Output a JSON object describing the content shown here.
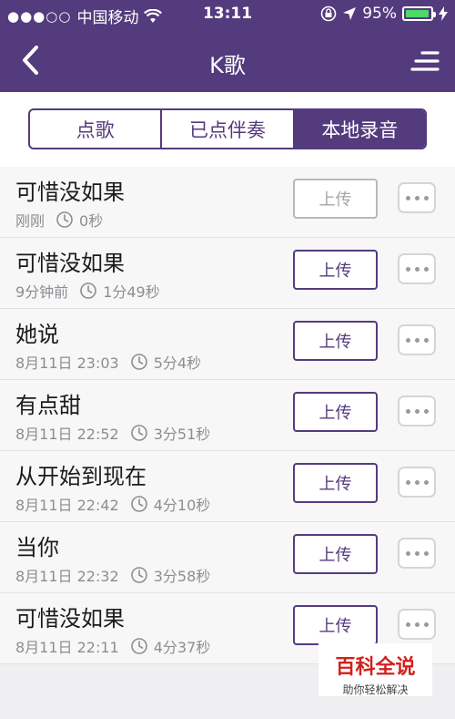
{
  "status": {
    "carrier": "中国移动",
    "time": "13:11",
    "battery_text": "95%",
    "battery_level": 0.95
  },
  "nav": {
    "title": "K歌"
  },
  "tabs": [
    {
      "label": "点歌",
      "active": false
    },
    {
      "label": "已点伴奏",
      "active": false
    },
    {
      "label": "本地录音",
      "active": true
    }
  ],
  "songs": [
    {
      "name": "可惜没如果",
      "date": "刚刚",
      "duration": "0秒",
      "upload_label": "上传",
      "upload_enabled": false
    },
    {
      "name": "可惜没如果",
      "date": "9分钟前",
      "duration": "1分49秒",
      "upload_label": "上传",
      "upload_enabled": true
    },
    {
      "name": "她说",
      "date": "8月11日 23:03",
      "duration": "5分4秒",
      "upload_label": "上传",
      "upload_enabled": true
    },
    {
      "name": "有点甜",
      "date": "8月11日 22:52",
      "duration": "3分51秒",
      "upload_label": "上传",
      "upload_enabled": true
    },
    {
      "name": "从开始到现在",
      "date": "8月11日 22:42",
      "duration": "4分10秒",
      "upload_label": "上传",
      "upload_enabled": true
    },
    {
      "name": "当你",
      "date": "8月11日 22:32",
      "duration": "3分58秒",
      "upload_label": "上传",
      "upload_enabled": true
    },
    {
      "name": "可惜没如果",
      "date": "8月11日 22:11",
      "duration": "4分37秒",
      "upload_label": "上传",
      "upload_enabled": true
    }
  ],
  "watermark": {
    "title": "百科全说",
    "subtitle": "助你轻松解决"
  },
  "colors": {
    "brand": "#543b7e",
    "battery": "#4cd964",
    "watermark": "#d1211b"
  }
}
